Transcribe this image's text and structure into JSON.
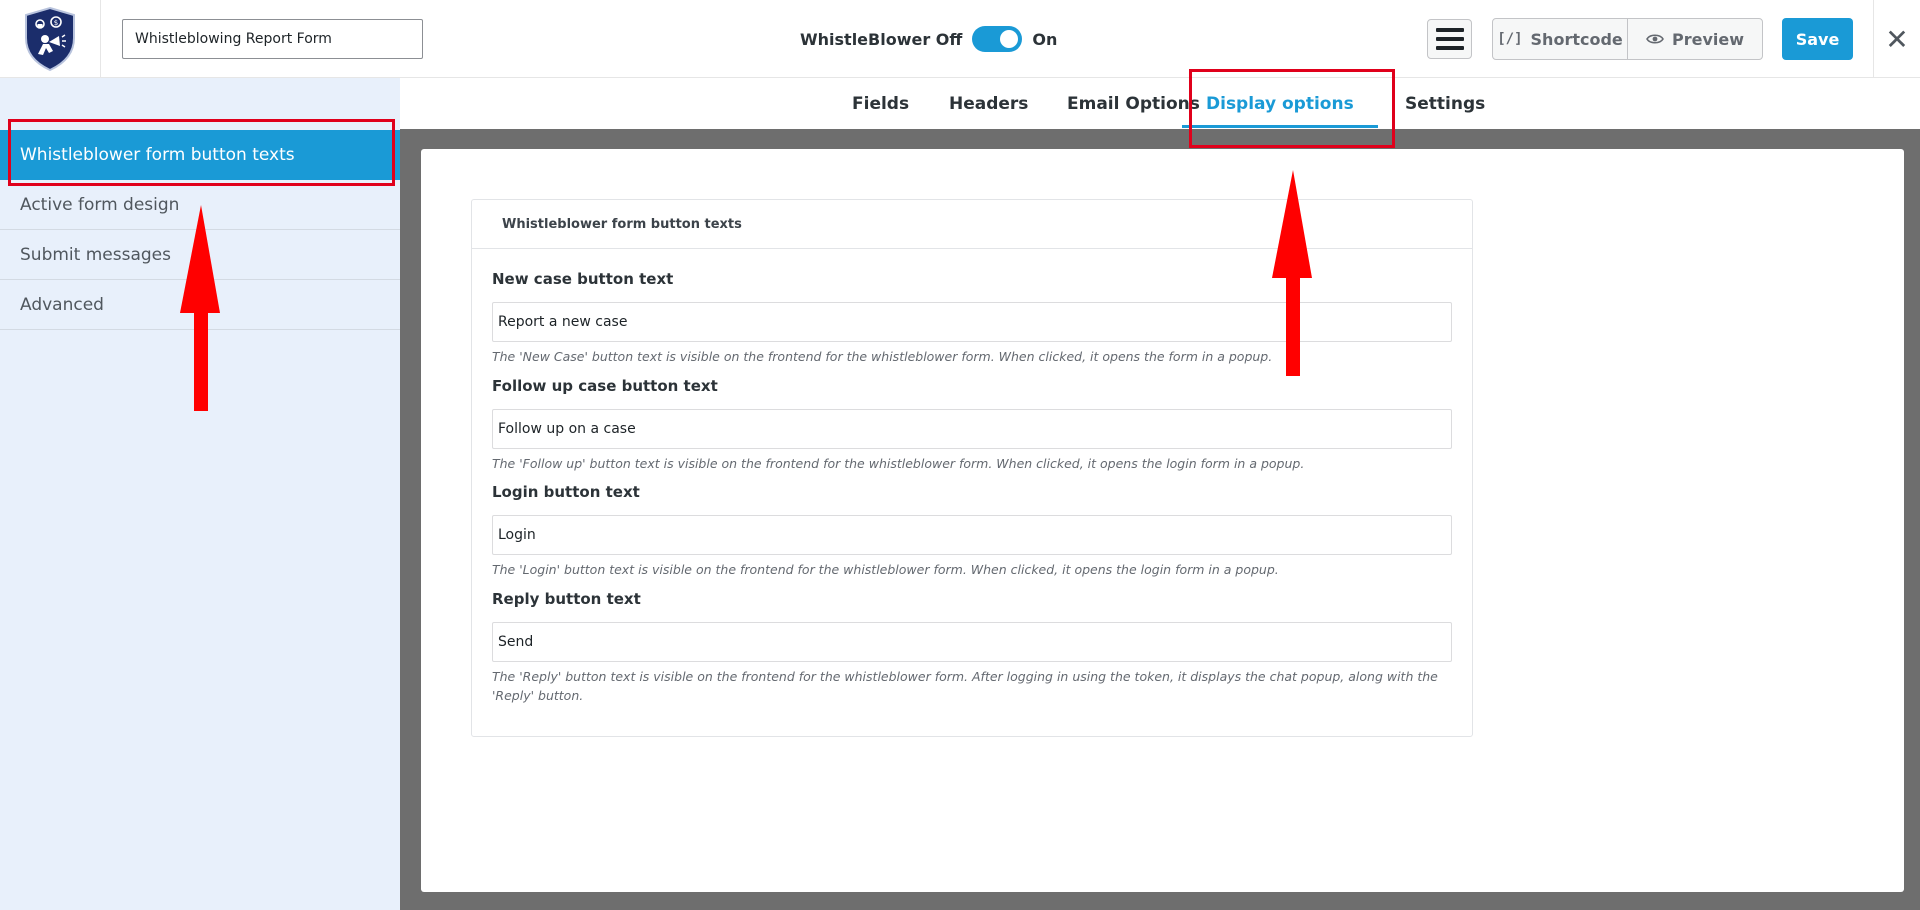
{
  "header": {
    "form_title_value": "Whistleblowing Report Form",
    "toggle_off_label": "WhistleBlower Off",
    "toggle_on_label": "On",
    "toggle_state": "on",
    "shortcode_icon": "[/]",
    "shortcode_label": "Shortcode",
    "preview_label": "Preview",
    "save_label": "Save",
    "close_glyph": "✕"
  },
  "sidebar": {
    "items": [
      {
        "label": "Whistleblower form button texts",
        "active": true
      },
      {
        "label": "Active form design",
        "active": false
      },
      {
        "label": "Submit messages",
        "active": false
      },
      {
        "label": "Advanced",
        "active": false
      }
    ]
  },
  "tabs": [
    {
      "label": "Fields",
      "active": false
    },
    {
      "label": "Headers",
      "active": false
    },
    {
      "label": "Email Options",
      "active": false
    },
    {
      "label": "Display options",
      "active": true
    },
    {
      "label": "Settings",
      "active": false
    }
  ],
  "panel": {
    "title": "Whistleblower form button texts",
    "fields": [
      {
        "label": "New case button text",
        "value": "Report a new case",
        "help": "The 'New Case' button text is visible on the frontend for the whistleblower form. When clicked, it opens the form in a popup."
      },
      {
        "label": "Follow up case button text",
        "value": "Follow up on a case",
        "help": "The 'Follow up' button text is visible on the frontend for the whistleblower form. When clicked, it opens the login form in a popup."
      },
      {
        "label": "Login button text",
        "value": "Login",
        "help": "The 'Login' button text is visible on the frontend for the whistleblower form. When clicked, it opens the login form in a popup."
      },
      {
        "label": "Reply button text",
        "value": "Send",
        "help": "The 'Reply' button text is visible on the frontend for the whistleblower form. After logging in using the token, it displays the chat popup, along with the 'Reply' button."
      }
    ]
  },
  "colors": {
    "accent": "#1a9ad6",
    "annotation_red": "#e0001b",
    "sidebar_bg": "#e8f0fb",
    "main_bg": "#6e6e6e",
    "logo_navy": "#1b2d6b"
  },
  "icons": {
    "logo": "shield-logo-icon",
    "menu": "hamburger-menu-icon",
    "shortcode": "shortcode-brackets-icon",
    "preview": "eye-icon",
    "close": "close-icon"
  }
}
